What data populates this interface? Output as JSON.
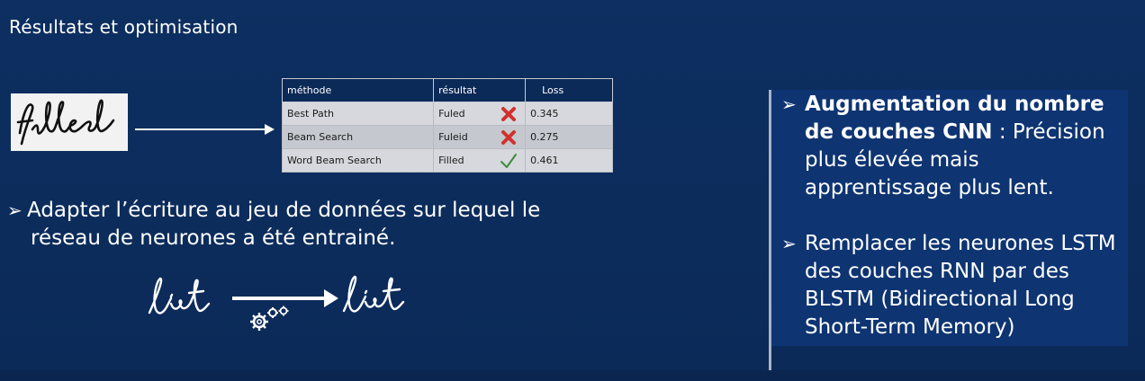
{
  "slide": {
    "title": "Résultats et optimisation"
  },
  "sample": {
    "handwriting_word": "filled"
  },
  "table": {
    "headers": [
      "méthode",
      "résultat",
      "Loss"
    ],
    "rows": [
      {
        "method": "Best Path",
        "result": "Fuled",
        "status": "incorrect",
        "status_icon": "red-x-icon",
        "loss": "0.345"
      },
      {
        "method": "Beam Search",
        "result": "Fuleid",
        "status": "incorrect",
        "status_icon": "red-x-icon",
        "loss": "0.275"
      },
      {
        "method": "Word Beam Search",
        "result": "Filled",
        "status": "correct",
        "status_icon": "green-check-icon",
        "loss": "0.461"
      }
    ]
  },
  "bullets": {
    "marker": "➢",
    "adapt_line1": "Adapter l’écriture au jeu de données sur lequel le",
    "adapt_line2": "réseau de neurones a été entrainé."
  },
  "list_example": {
    "before": "list",
    "after": "list",
    "icon": "gears-icon"
  },
  "panel": {
    "items": [
      {
        "bold": "Augmentation du nombre de couches CNN",
        "rest": " : Précision plus élevée mais apprentissage plus lent."
      },
      {
        "bold": "",
        "rest": "Remplacer les neurones LSTM  des couches RNN par des BLSTM (Bidirectional Long Short-Term Memory)"
      }
    ]
  },
  "colors": {
    "background": "#0c2d5e",
    "panel": "#0e3472",
    "incorrect": "#d0312d",
    "correct": "#3c8c3c"
  }
}
